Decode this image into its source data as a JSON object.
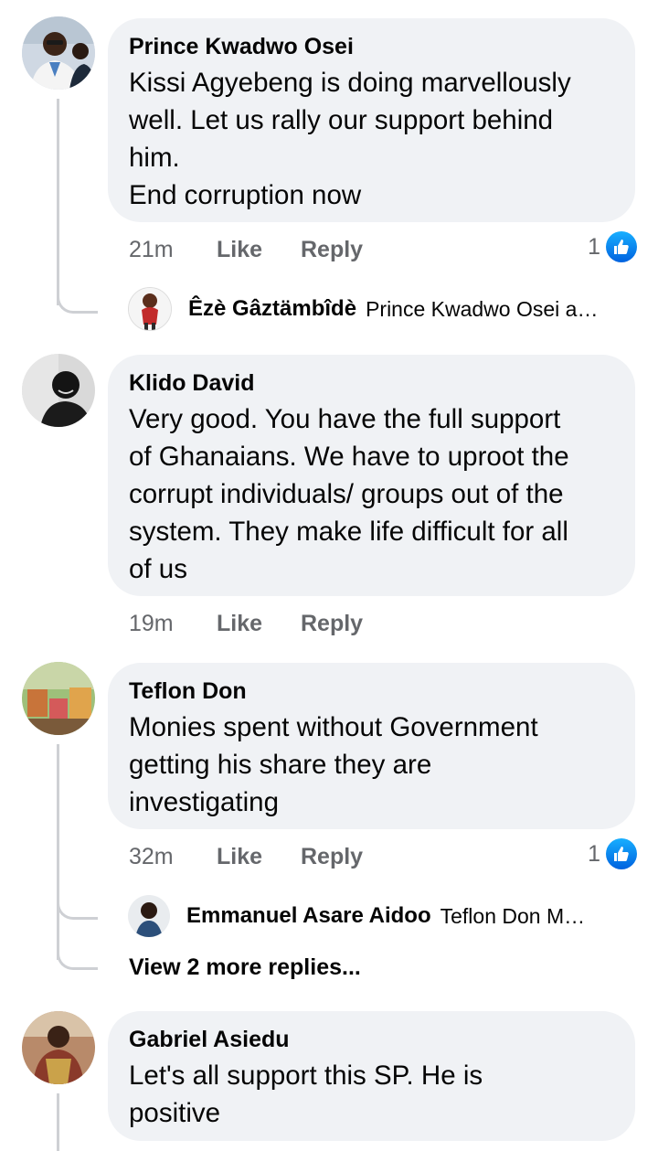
{
  "comments": [
    {
      "author": "Prince Kwadwo Osei",
      "text": "Kissi Agyebeng is doing marvellously\nwell. Let us rally our support behind\nhim.\nEnd corruption now",
      "time": "21m",
      "like": "Like",
      "reply": "Reply",
      "reaction_count": "1",
      "reply_preview": {
        "author": "Êzè Gâztämbîdè",
        "text": "Prince Kwadwo Osei a…"
      }
    },
    {
      "author": "Klido David",
      "text": "Very good. You have the full support\nof Ghanaians. We have to uproot the\ncorrupt individuals/ groups out of the\nsystem. They make life difficult for all\nof us",
      "time": "19m",
      "like": "Like",
      "reply": "Reply"
    },
    {
      "author": "Teflon Don",
      "text": "Monies spent without Government\ngetting his share they are\ninvestigating",
      "time": "32m",
      "like": "Like",
      "reply": "Reply",
      "reaction_count": "1",
      "reply_preview": {
        "author": "Emmanuel Asare Aidoo",
        "text": "Teflon Don  M…"
      },
      "more_replies": "View 2 more replies..."
    },
    {
      "author": "Gabriel Asiedu",
      "text": "Let's all support this SP. He is\npositive"
    }
  ],
  "colors": {
    "bubble": "#f0f2f5",
    "meta_text": "#65676b",
    "like_blue": "#1877f2",
    "thread_line": "#ced0d4"
  },
  "icons": {
    "reaction": "like-thumb-icon"
  }
}
